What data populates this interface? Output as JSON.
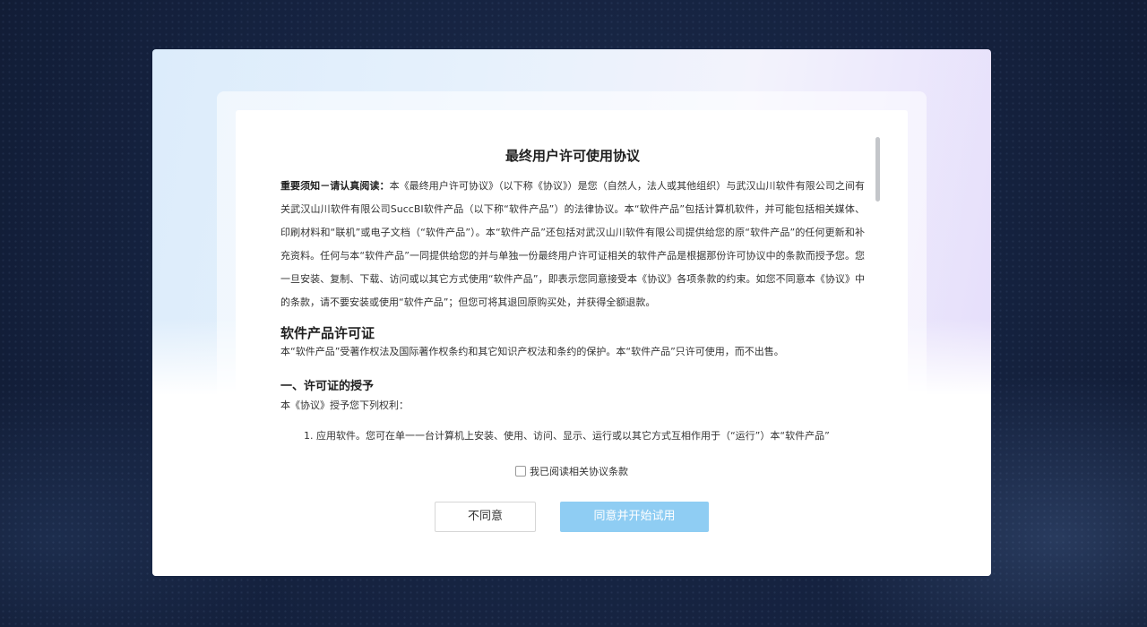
{
  "dialog": {
    "title": "最终用户许可使用协议",
    "intro_label": "重要须知－请认真阅读：",
    "intro_text": "本《最终用户许可协议》（以下称《协议》）是您（自然人，法人或其他组织）与武汉山川软件有限公司之间有关武汉山川软件有限公司SuccBI软件产品（以下称“软件产品”）的法律协议。本“软件产品”包括计算机软件，并可能包括相关媒体、印刷材料和“联机”或电子文档（“软件产品”）。本“软件产品”还包括对武汉山川软件有限公司提供给您的原“软件产品”的任何更新和补充资料。任何与本“软件产品”一同提供给您的并与单独一份最终用户许可证相关的软件产品是根据那份许可协议中的条款而授予您。您一旦安装、复制、下载、访问或以其它方式使用“软件产品”，即表示您同意接受本《协议》各项条款的约束。如您不同意本《协议》中的条款，请不要安装或使用“软件产品”；但您可将其退回原购买处，并获得全额退款。",
    "section_title": "软件产品许可证",
    "section_text": "本“软件产品”受著作权法及国际著作权条约和其它知识产权法和条约的保护。本“软件产品”只许可使用，而不出售。",
    "subsection_title": "一、许可证的授予",
    "subsection_text": "本《协议》授予您下列权利：",
    "list_item_1": "1. 应用软件。您可在单一一台计算机上安装、使用、访问、显示、运行或以其它方式互相作用于（“运行”）本“软件产品”",
    "agree_checkbox_label": "我已阅读相关协议条款",
    "agree_checked": false,
    "disagree_button": "不同意",
    "agree_button": "同意并开始试用"
  },
  "colors": {
    "page_background": "#15223f",
    "primary_button_disabled": "#8fcdf3",
    "primary_button_text": "#ffffff"
  }
}
